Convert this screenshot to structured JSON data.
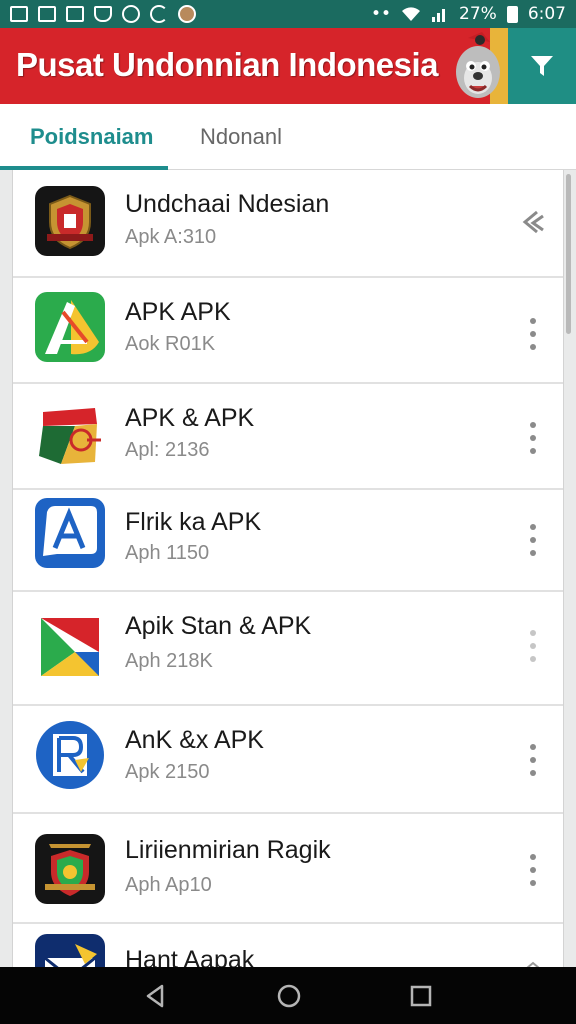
{
  "status_bar": {
    "left_icons": [
      "gallery-icon",
      "photo-icon",
      "image-icon",
      "shield-icon",
      "chrome-icon",
      "sync-icon",
      "avatar-icon"
    ],
    "battery_text": "27%",
    "time": "6:07"
  },
  "app_bar": {
    "title": "Pusat Undonnian Indonesia",
    "mascot_icon": "mascot-icon",
    "filter_icon": "filter-icon",
    "primary_color": "#d6242a",
    "accent_color": "#1f8e84"
  },
  "tabs": [
    {
      "label": "Poidsnaiam",
      "active": true
    },
    {
      "label": "Ndonanl",
      "active": false
    }
  ],
  "apps": [
    {
      "name": "Undchaai Ndesian",
      "meta": "Apk A:310",
      "icon": "shield-crest-icon",
      "action": "share-icon"
    },
    {
      "name": "APK APK",
      "meta": "Aok R01K",
      "icon": "triangle-logo-icon",
      "action": "more-icon"
    },
    {
      "name": "APK & APK",
      "meta": "Apl: 2136",
      "icon": "flag-emblem-icon",
      "action": "more-icon"
    },
    {
      "name": "Flrik ka APK",
      "meta": "Aph 1150",
      "icon": "letter-a-icon",
      "action": "more-icon"
    },
    {
      "name": "Apik Stan & APK",
      "meta": "Aph 218K",
      "icon": "play-arrow-icon",
      "action": "more-icon"
    },
    {
      "name": "AnK &x APK",
      "meta": "Apk 2150",
      "icon": "r-logo-icon",
      "action": "more-icon"
    },
    {
      "name": "Liriienmirian Ragik",
      "meta": "Aph Ap10",
      "icon": "crest-icon",
      "action": "more-icon"
    },
    {
      "name": "Hant Aapak",
      "meta": "",
      "icon": "mail-icon",
      "action": "more-icon"
    }
  ],
  "nav_bar": {
    "back_icon": "back-icon",
    "home_icon": "home-icon",
    "recents_icon": "recents-icon"
  }
}
